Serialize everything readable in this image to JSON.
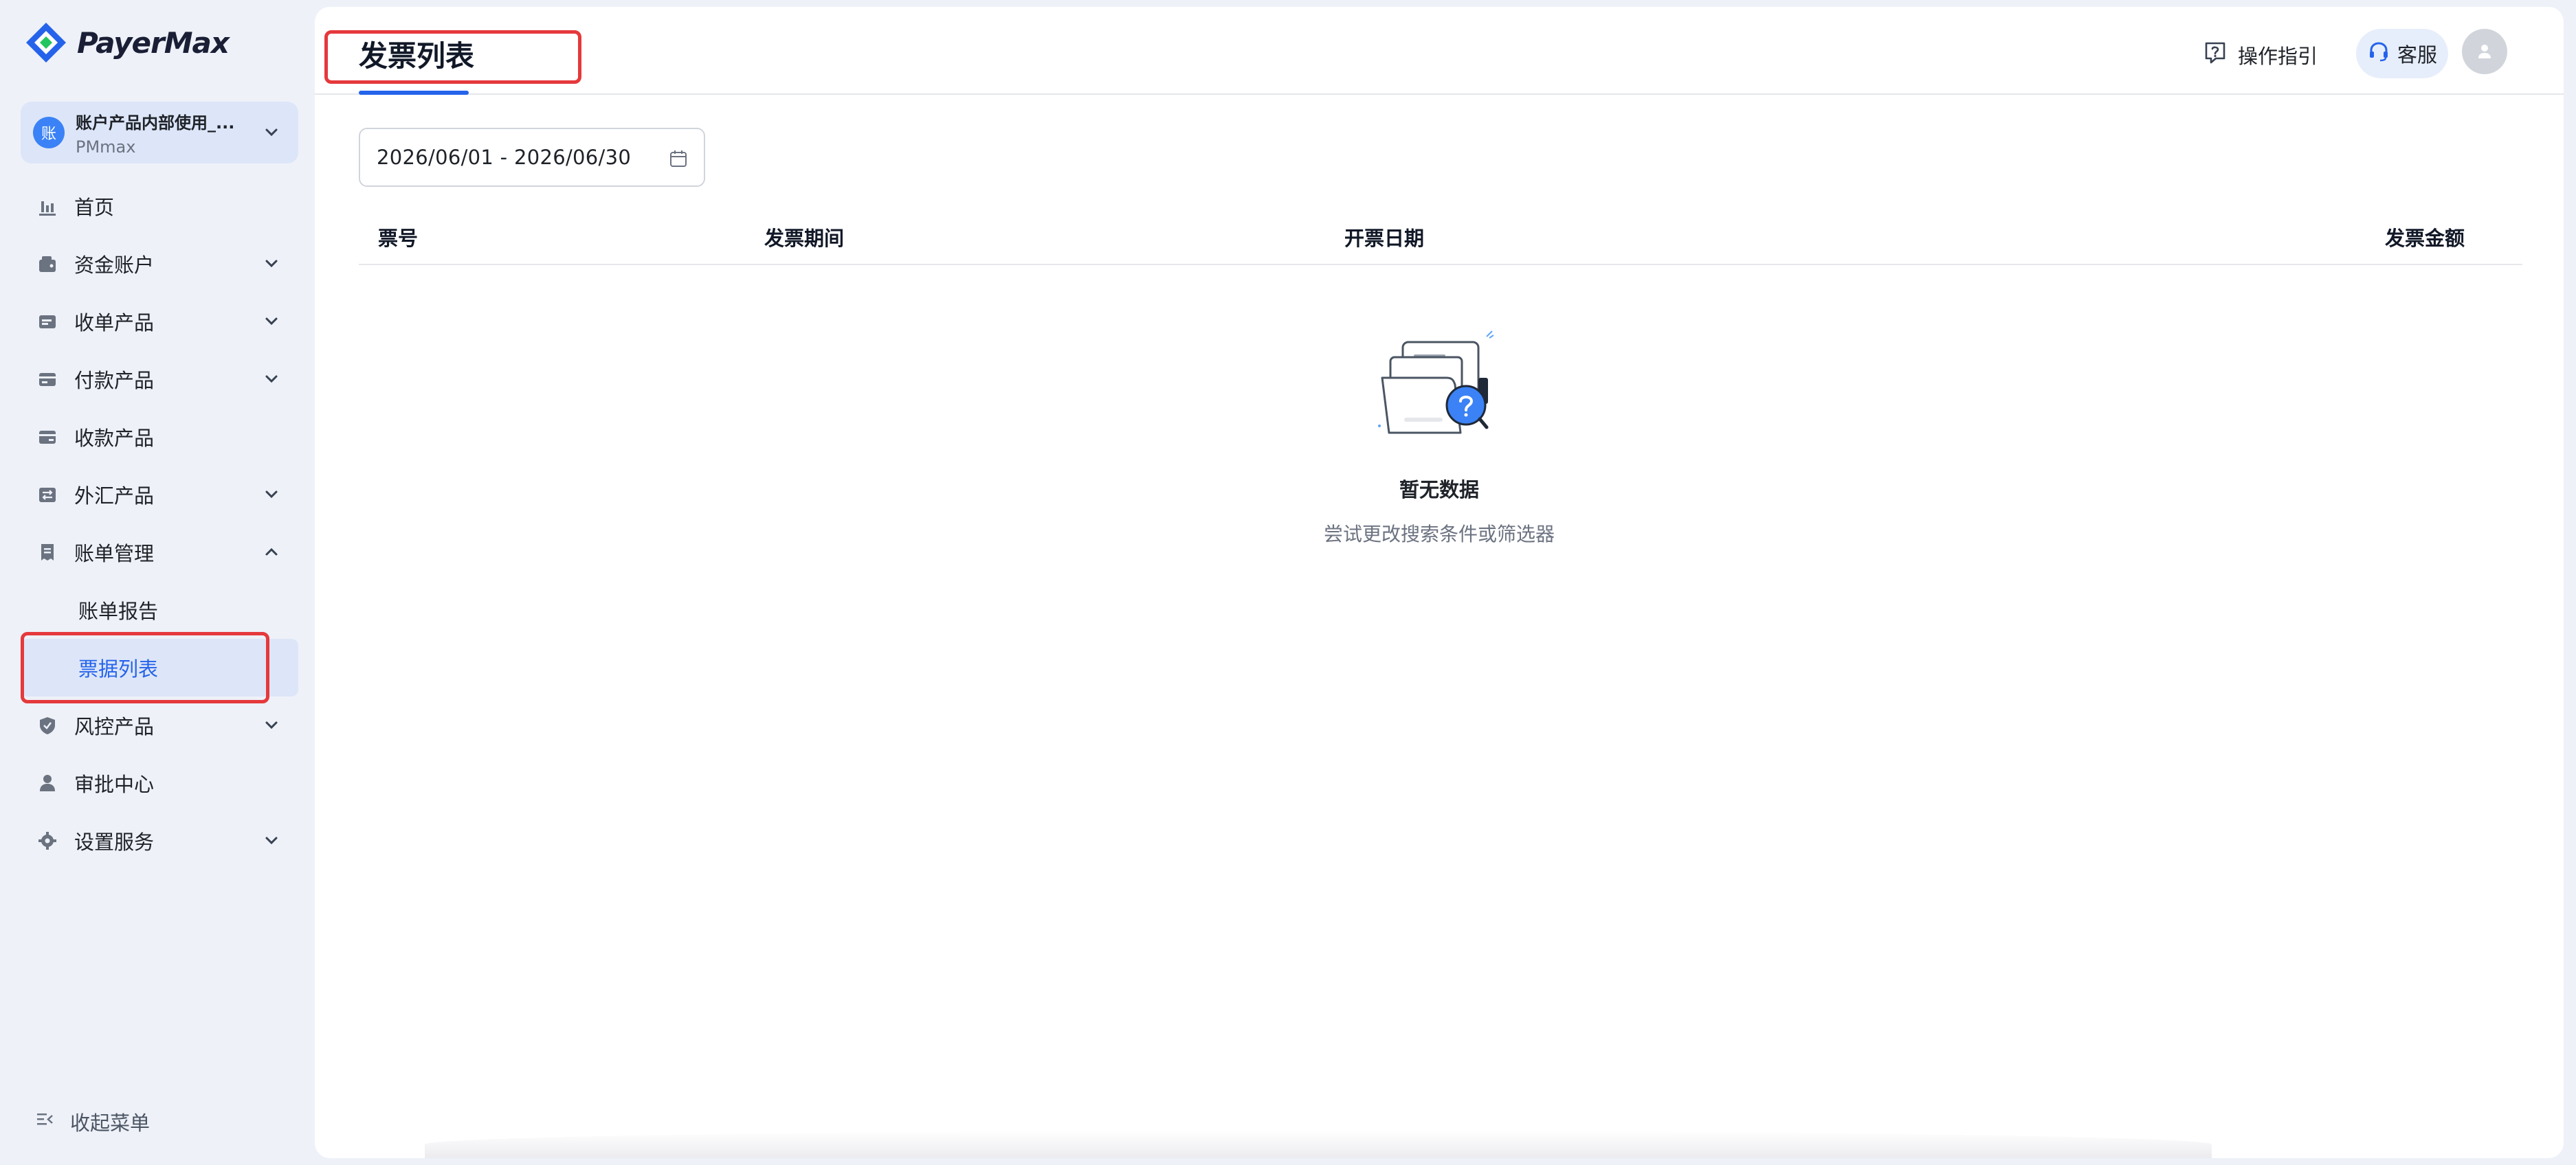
{
  "brand": {
    "name": "PayerMax",
    "accent": "#2563eb",
    "highlight": "#e5393c"
  },
  "account": {
    "avatar_char": "账",
    "name": "账户产品内部使用_...",
    "sub": "PMmax"
  },
  "nav": {
    "home": "首页",
    "funds": "资金账户",
    "collect": "收单产品",
    "payout": "付款产品",
    "receive": "收款产品",
    "fx": "外汇产品",
    "billing": "账单管理",
    "billing_report": "账单报告",
    "invoice_list": "票据列表",
    "risk": "风控产品",
    "approval": "审批中心",
    "settings": "设置服务",
    "collapse": "收起菜单"
  },
  "header": {
    "title": "发票列表",
    "guide": "操作指引",
    "support": "客服"
  },
  "filter": {
    "date_range": "2026/06/01 - 2026/06/30"
  },
  "table": {
    "columns": [
      "票号",
      "发票期间",
      "开票日期",
      "发票金额"
    ]
  },
  "empty": {
    "title": "暂无数据",
    "subtitle": "尝试更改搜索条件或筛选器"
  }
}
